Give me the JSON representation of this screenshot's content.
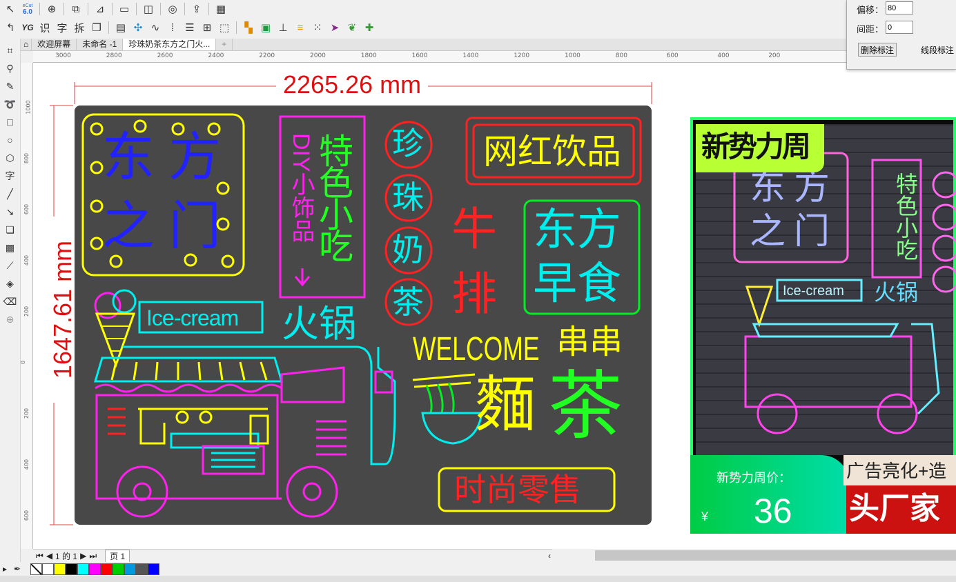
{
  "toolbar": {
    "app_version_top": "eCut",
    "app_version": "6.0",
    "yg_label": "YG",
    "chars": [
      "识",
      "字",
      "拆"
    ]
  },
  "tabs": [
    {
      "label": "欢迎屏幕"
    },
    {
      "label": "未命名 -1"
    },
    {
      "label": "珍珠奶茶东方之门火..."
    },
    {
      "label": "+"
    }
  ],
  "ruler": {
    "h": [
      "3000",
      "2800",
      "2600",
      "2400",
      "2200",
      "2000",
      "1800",
      "1600",
      "1400",
      "1200",
      "1000",
      "800",
      "600",
      "400",
      "200"
    ],
    "v": [
      "1000",
      "800",
      "600",
      "400",
      "200",
      "0",
      "200",
      "400",
      "600"
    ]
  },
  "props": {
    "offset_label": "偏移：",
    "offset_value": "80",
    "spacing_label": "间距：",
    "spacing_value": "0",
    "delete_btn": "删除标注",
    "segment_btn": "线段标注"
  },
  "dims": {
    "width": "2265.26 mm",
    "height": "1647.61 mm"
  },
  "design": {
    "dongfang": [
      "东",
      "方",
      "之",
      "门"
    ],
    "tese": "特色小吃",
    "diy": "DIY小饰品",
    "zhenzhu": [
      "珍",
      "珠",
      "奶",
      "茶"
    ],
    "wanghong": "网红饮品",
    "niupai": [
      "牛",
      "排"
    ],
    "zaoshi": [
      "东方",
      "早食"
    ],
    "icecream": "Ice-cream",
    "huoguo": "火锅",
    "welcome": "WELCOME",
    "chuan": "串串",
    "mian": "麵",
    "cha": "茶",
    "retail": "时尚零售"
  },
  "photo": {
    "tag": "新势力周",
    "price_label": "新势力周价：",
    "currency": "¥",
    "price": "36",
    "ad_text": "广告亮化+造",
    "factory": "头厂家"
  },
  "pagebar": {
    "pages": "1 的 1",
    "page_tab": "页 1"
  },
  "palette": [
    "#ffffff",
    "#ffff00",
    "#000000",
    "#00ffff",
    "#ff00ff",
    "#ff0000",
    "#00cc00",
    "#0099dd",
    "#555555",
    "#0000ff"
  ]
}
